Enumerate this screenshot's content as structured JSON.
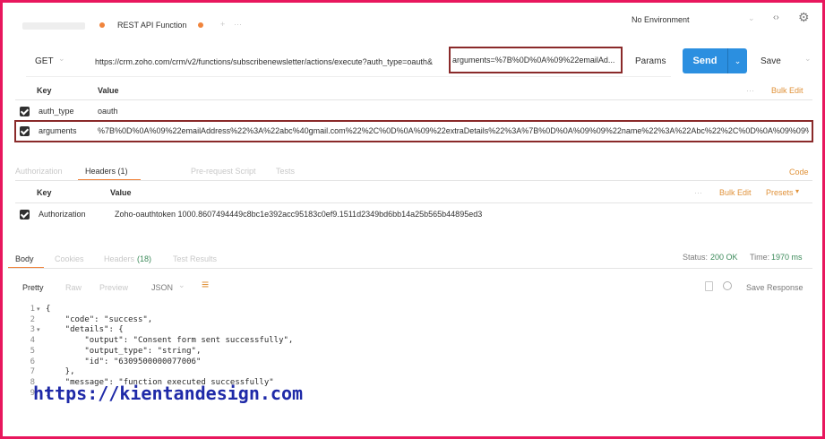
{
  "tabs": [
    {
      "label": "REST API Function"
    }
  ],
  "tab_more": "···",
  "environment": "No Environment",
  "request": {
    "method": "GET",
    "url_prefix": "https://crm.zoho.com/crm/v2/functions/subscribenewsletter/actions/execute?auth_type=oauth&",
    "url_highlight": "arguments=%7B%0D%0A%09%22emailAd...",
    "params_label": "Params",
    "send_label": "Send",
    "save_label": "Save"
  },
  "params_table": {
    "key_header": "Key",
    "value_header": "Value",
    "more": "···",
    "bulk_edit": "Bulk Edit",
    "rows": [
      {
        "key": "auth_type",
        "value": "oauth"
      },
      {
        "key": "arguments",
        "value": "%7B%0D%0A%09%22emailAddress%22%3A%22abc%40gmail.com%22%2C%0D%0A%09%22extraDetails%22%3A%7B%0D%0A%09%09%22name%22%3A%22Abc%22%2C%0D%0A%09%09%2..."
      }
    ]
  },
  "request_tabs": {
    "authorization": "Authorization",
    "headers": "Headers (1)",
    "pre_request": "Pre-request Script",
    "tests": "Tests",
    "code": "Code"
  },
  "headers_table": {
    "key_header": "Key",
    "value_header": "Value",
    "more": "···",
    "bulk_edit": "Bulk Edit",
    "presets": "Presets",
    "rows": [
      {
        "key": "Authorization",
        "value": "Zoho-oauthtoken 1000.8607494449c8bc1e392acc95183c0ef9.1511d2349bd6bb14a25b565b44895ed3"
      }
    ]
  },
  "response_tabs": {
    "body": "Body",
    "cookies": "Cookies",
    "headers": "Headers",
    "headers_count": "(18)",
    "test_results": "Test Results"
  },
  "response_status": {
    "status_label": "Status:",
    "status_value": "200 OK",
    "time_label": "Time:",
    "time_value": "1970 ms"
  },
  "body_toolbar": {
    "pretty": "Pretty",
    "raw": "Raw",
    "preview": "Preview",
    "format": "JSON",
    "save_response": "Save Response"
  },
  "response_body": {
    "line_numbers": [
      "1",
      "2",
      "3",
      "4",
      "5",
      "6",
      "7",
      "8",
      "9"
    ],
    "lines": [
      "{",
      "    \"code\": \"success\",",
      "    \"details\": {",
      "        \"output\": \"Consent form sent successfully\",",
      "        \"output_type\": \"string\",",
      "        \"id\": \"6309500000077006\"",
      "    },",
      "    \"message\": \"function executed successfully\"",
      "}"
    ]
  },
  "watermark": "https://kientandesign.com",
  "icons": {
    "eye": "eye-icon",
    "settings": "gear-icon",
    "chevron": "chevron-down-icon",
    "wrap": "wrap-lines-icon",
    "copy": "copy-icon",
    "search": "search-icon"
  },
  "colors": {
    "accent": "#f0843c",
    "send": "#2b8fe0",
    "status_ok": "#3c8a5a",
    "border_frame": "#e8175d",
    "highlight_box": "#8a2a2a"
  }
}
